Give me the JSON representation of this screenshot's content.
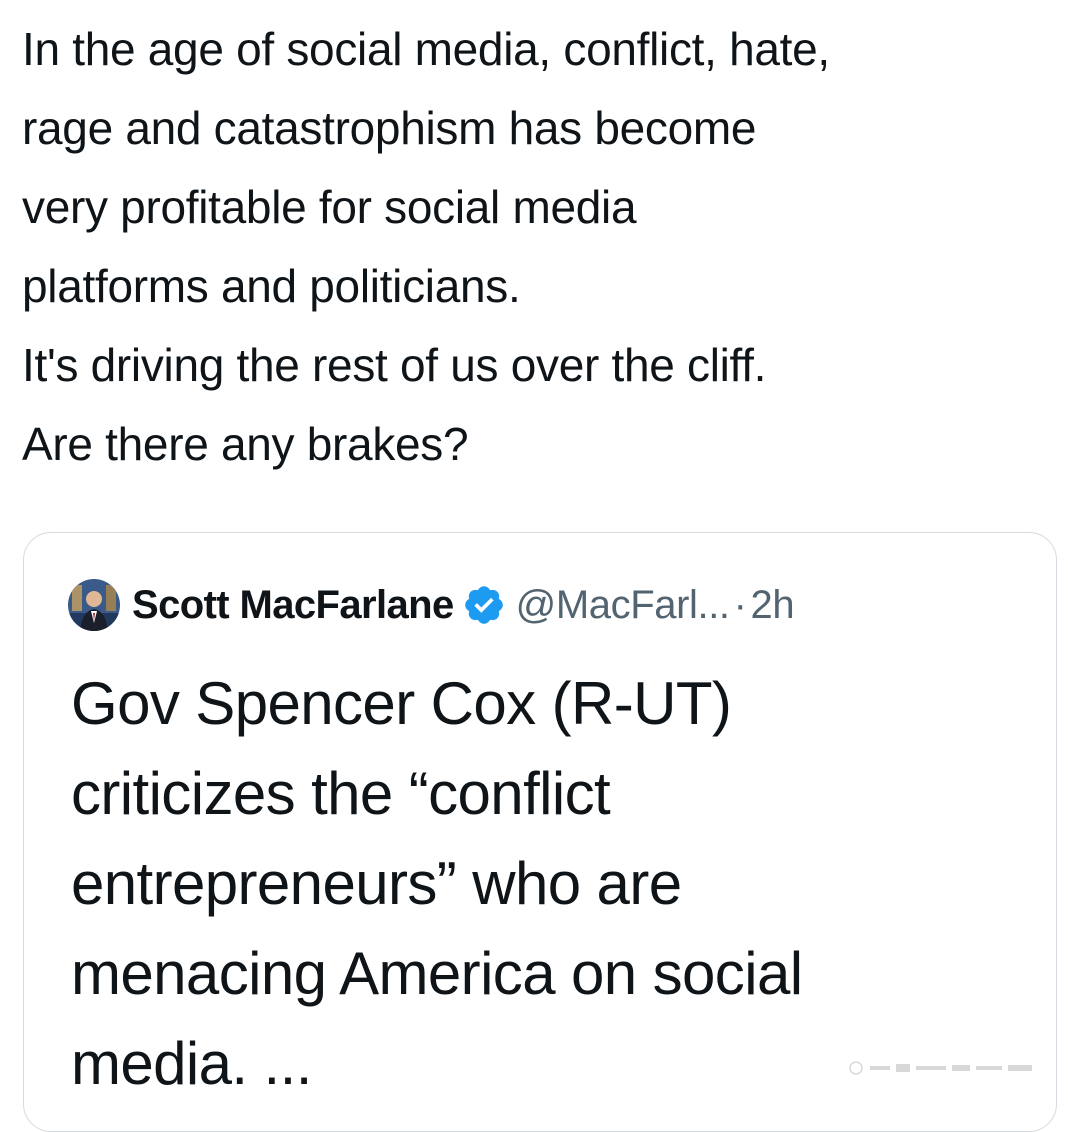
{
  "tweet": {
    "lines": [
      "In the age of social media, conflict, hate,",
      "rage and catastrophism has become",
      "very profitable for social  media",
      "platforms and politicians.",
      "It's driving the rest of us over the cliff.",
      "Are there any brakes?"
    ]
  },
  "quoted_tweet": {
    "author_name": "Scott MacFarlane",
    "handle": "@MacFarl...",
    "separator": "·",
    "timestamp": "2h",
    "verified_color": "#1d9bf0",
    "avatar_icon": "avatar-photo",
    "verified_icon": "verified-badge-icon",
    "lines": [
      "Gov Spencer Cox (R-UT)",
      "criticizes the “conflict",
      "entrepreneurs” who are",
      "menacing America on social",
      "media. ..."
    ]
  },
  "colors": {
    "text": "#0f1419",
    "secondary": "#536471",
    "border": "#d5dbe0"
  }
}
